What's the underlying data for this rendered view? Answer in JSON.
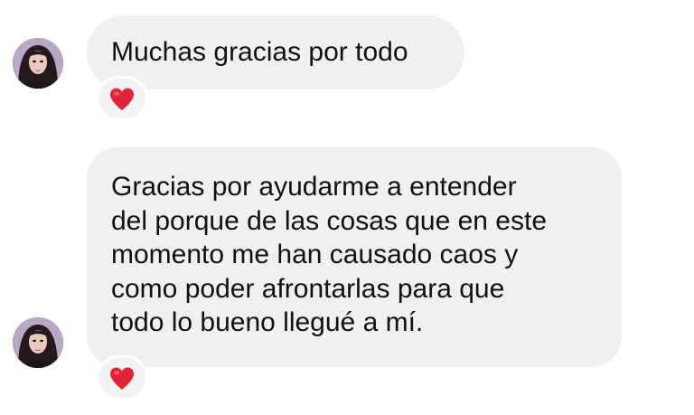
{
  "messages": [
    {
      "text": "Muchas gracias por todo",
      "reaction": "heart-emoji"
    },
    {
      "text": "Gracias por ayudarme a entender\ndel porque de las cosas que en este\nmomento me han causado caos y\ncomo poder afrontarlas para que\ntodo lo bueno llegué a mí.",
      "reaction": "heart-emoji"
    }
  ],
  "colors": {
    "bubble": "#f0f0f2",
    "text": "#111111",
    "heart": "#e0243a"
  }
}
